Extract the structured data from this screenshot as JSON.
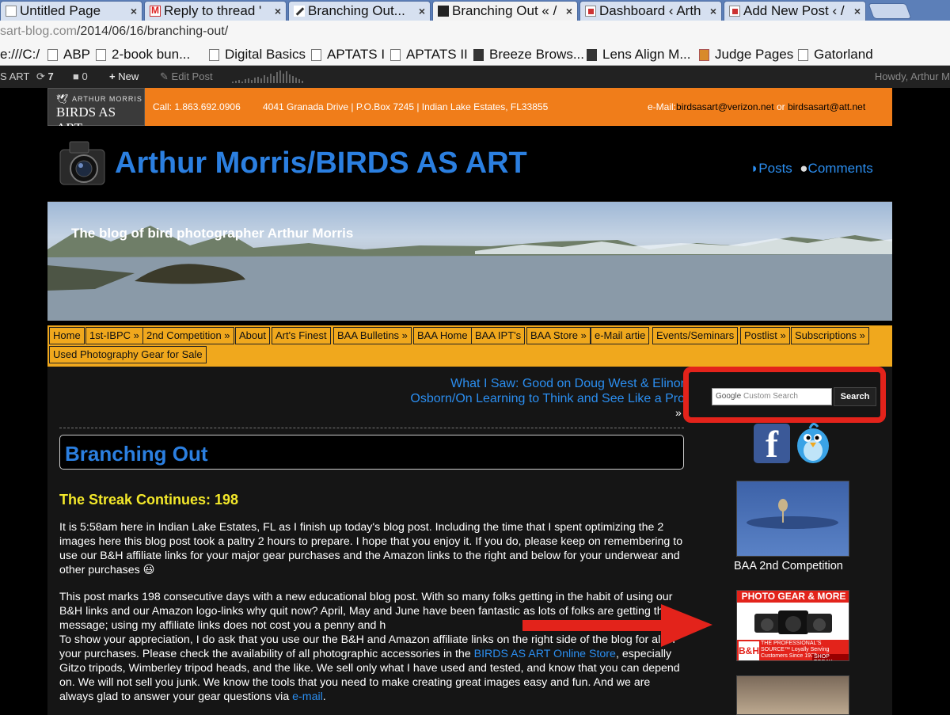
{
  "tabs": [
    {
      "title": "Untitled Page",
      "icon": "page-icon"
    },
    {
      "title": "Reply to thread '",
      "icon": "gmail-icon"
    },
    {
      "title": "Branching Out...",
      "icon": "pen-icon"
    },
    {
      "title": "Branching Out « /",
      "icon": "baa-icon",
      "active": true
    },
    {
      "title": "Dashboard ‹ Arth",
      "icon": "wordpress-icon"
    },
    {
      "title": "Add New Post ‹ /",
      "icon": "wordpress-icon"
    }
  ],
  "tab_close": "×",
  "address": {
    "dim_prefix": "sart-blog.com",
    "path": "/2014/06/16/branching-out/"
  },
  "bookmarks": [
    "e:///C:/",
    "ABP",
    "2-book bun...",
    "Digital Basics",
    "APTATS I",
    "APTATS II",
    "Breeze Brows...",
    "Lens Align M...",
    "Judge Pages",
    "Gatorland"
  ],
  "adminbar": {
    "site": "S ART",
    "updates": "7",
    "comments": "0",
    "new": "New",
    "edit": "Edit Post",
    "howdy": "Howdy, Arthur M"
  },
  "topbar": {
    "logo_top": "ARTHUR MORRIS",
    "logo_main": "BIRDS AS ART",
    "call": "Call: 1.863.692.0906",
    "address": "4041 Granada Drive | P.O.Box 7245 | Indian Lake Estates, FL33855",
    "email_label": "e-Mail:",
    "email1": "birdsasart@verizon.net",
    "email_or": "or",
    "email2": "birdsasart@att.net"
  },
  "header": {
    "title": "Arthur Morris/BIRDS AS ART",
    "posts": "Posts",
    "comments": "Comments"
  },
  "banner": {
    "tagline": "The blog of bird photographer Arthur Morris"
  },
  "nav": [
    "Home",
    "1st-IBPC »",
    "2nd Competition »",
    "About",
    "Art's Finest",
    "BAA Bulletins »",
    "BAA Home",
    "BAA IPT's",
    "BAA Store »",
    "e-Mail artie",
    "Events/Seminars",
    "Postlist »",
    "Subscriptions »",
    "Used Photography Gear for Sale"
  ],
  "prev_post": {
    "line1": "What I Saw: Good on Doug West & Elinor",
    "line2": "Osborn/On Learning to Think and See Like a Pro",
    "arrow": "»"
  },
  "post": {
    "title": "Branching Out",
    "subhead": "The Streak Continues: 198",
    "p1": "It is 5:58am here in Indian Lake Estates, FL as I finish up today's blog post. Including the time that I spent optimizing the 2 images here this blog post took a paltry 2 hours to prepare. I hope that you enjoy it. If you do, please keep on remembering to use our B&H affiliate links for your major gear purchases and the Amazon links to the right and below for your underwear and other purchases 😃",
    "p2a": "This post marks 198 consecutive days with a new educational blog post. With so many folks getting in the habit of using our B&H links and our Amazon logo-links why quit now? April, May and June have been fantastic as lots of folks are getting the message; using my affiliate links does not cost you a penny and h",
    "p2b": "To show your appreciation, I do ask that you use our the B&H and Amazon affiliate links on the right side of the blog for all of your purchases. Please check the availability of all photographic accessories in the ",
    "p2_link": "BIRDS AS ART Online Store",
    "p2c": ", especially Gitzo tripods, Wimberley tripod heads, and the like. We sell only what I have used and tested, and know that you can depend on. We will not sell you junk. We know the tools that you need to make creating great images easy and fun. And we are always glad to answer your gear questions via ",
    "p2_email": "e-mail",
    "p2d": "."
  },
  "sidebar": {
    "search_brand": "Google",
    "search_placeholder": "Custom Search",
    "search_button": "Search",
    "facebook": "f",
    "ad1_caption": "BAA 2nd Competition",
    "ad2_header": "PHOTO GEAR & MORE",
    "ad2_bh": "B&H",
    "ad2_source": "THE PROFESSIONAL'S SOURCE™ Loyally Serving Customers Since 1973",
    "ad2_shop": "SHOP TODAY"
  },
  "colors": {
    "accent_blue": "#2b7fe0",
    "topbar_orange": "#f07d1a",
    "nav_gold": "#f0a81d",
    "highlight_red": "#e3231b",
    "subhead_yellow": "#f3e82a"
  }
}
